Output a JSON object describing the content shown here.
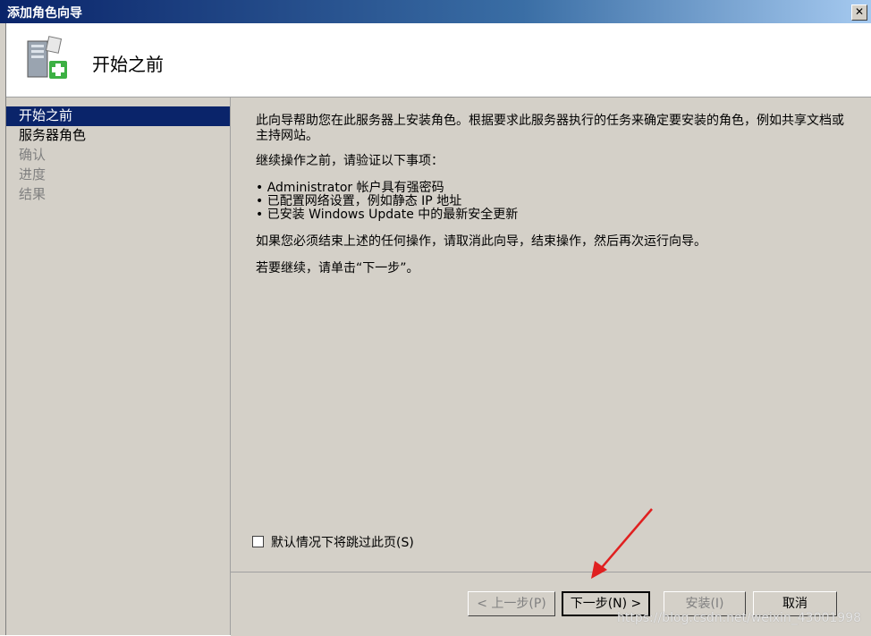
{
  "window": {
    "title": "添加角色向导",
    "close_symbol": "✕"
  },
  "header": {
    "page_title": "开始之前",
    "icon": "server-add-icon"
  },
  "nav": {
    "items": [
      {
        "label": "开始之前",
        "state": "active"
      },
      {
        "label": "服务器角色",
        "state": "normal"
      },
      {
        "label": "确认",
        "state": "disabled"
      },
      {
        "label": "进度",
        "state": "disabled"
      },
      {
        "label": "结果",
        "state": "disabled"
      }
    ]
  },
  "content": {
    "intro": "此向导帮助您在此服务器上安装角色。根据要求此服务器执行的任务来确定要安装的角色，例如共享文档或主持网站。",
    "pre_check": "继续操作之前，请验证以下事项：",
    "bullets": [
      "Administrator 帐户具有强密码",
      "已配置网络设置，例如静态 IP 地址",
      "已安装 Windows Update 中的最新安全更新"
    ],
    "cancel_note": "如果您必须结束上述的任何操作，请取消此向导，结束操作，然后再次运行向导。",
    "continue_note": "若要继续，请单击“下一步”。",
    "skip_label": "默认情况下将跳过此页(S)",
    "skip_checked": false
  },
  "buttons": {
    "back": "< 上一步(P)",
    "next": "下一步(N) >",
    "install": "安装(I)",
    "cancel": "取消"
  },
  "watermark": "https://blog.csdn.net/weixin_43001998",
  "colors": {
    "selection": "#0a246a",
    "face": "#d4d0c8",
    "arrow": "#e02020"
  }
}
